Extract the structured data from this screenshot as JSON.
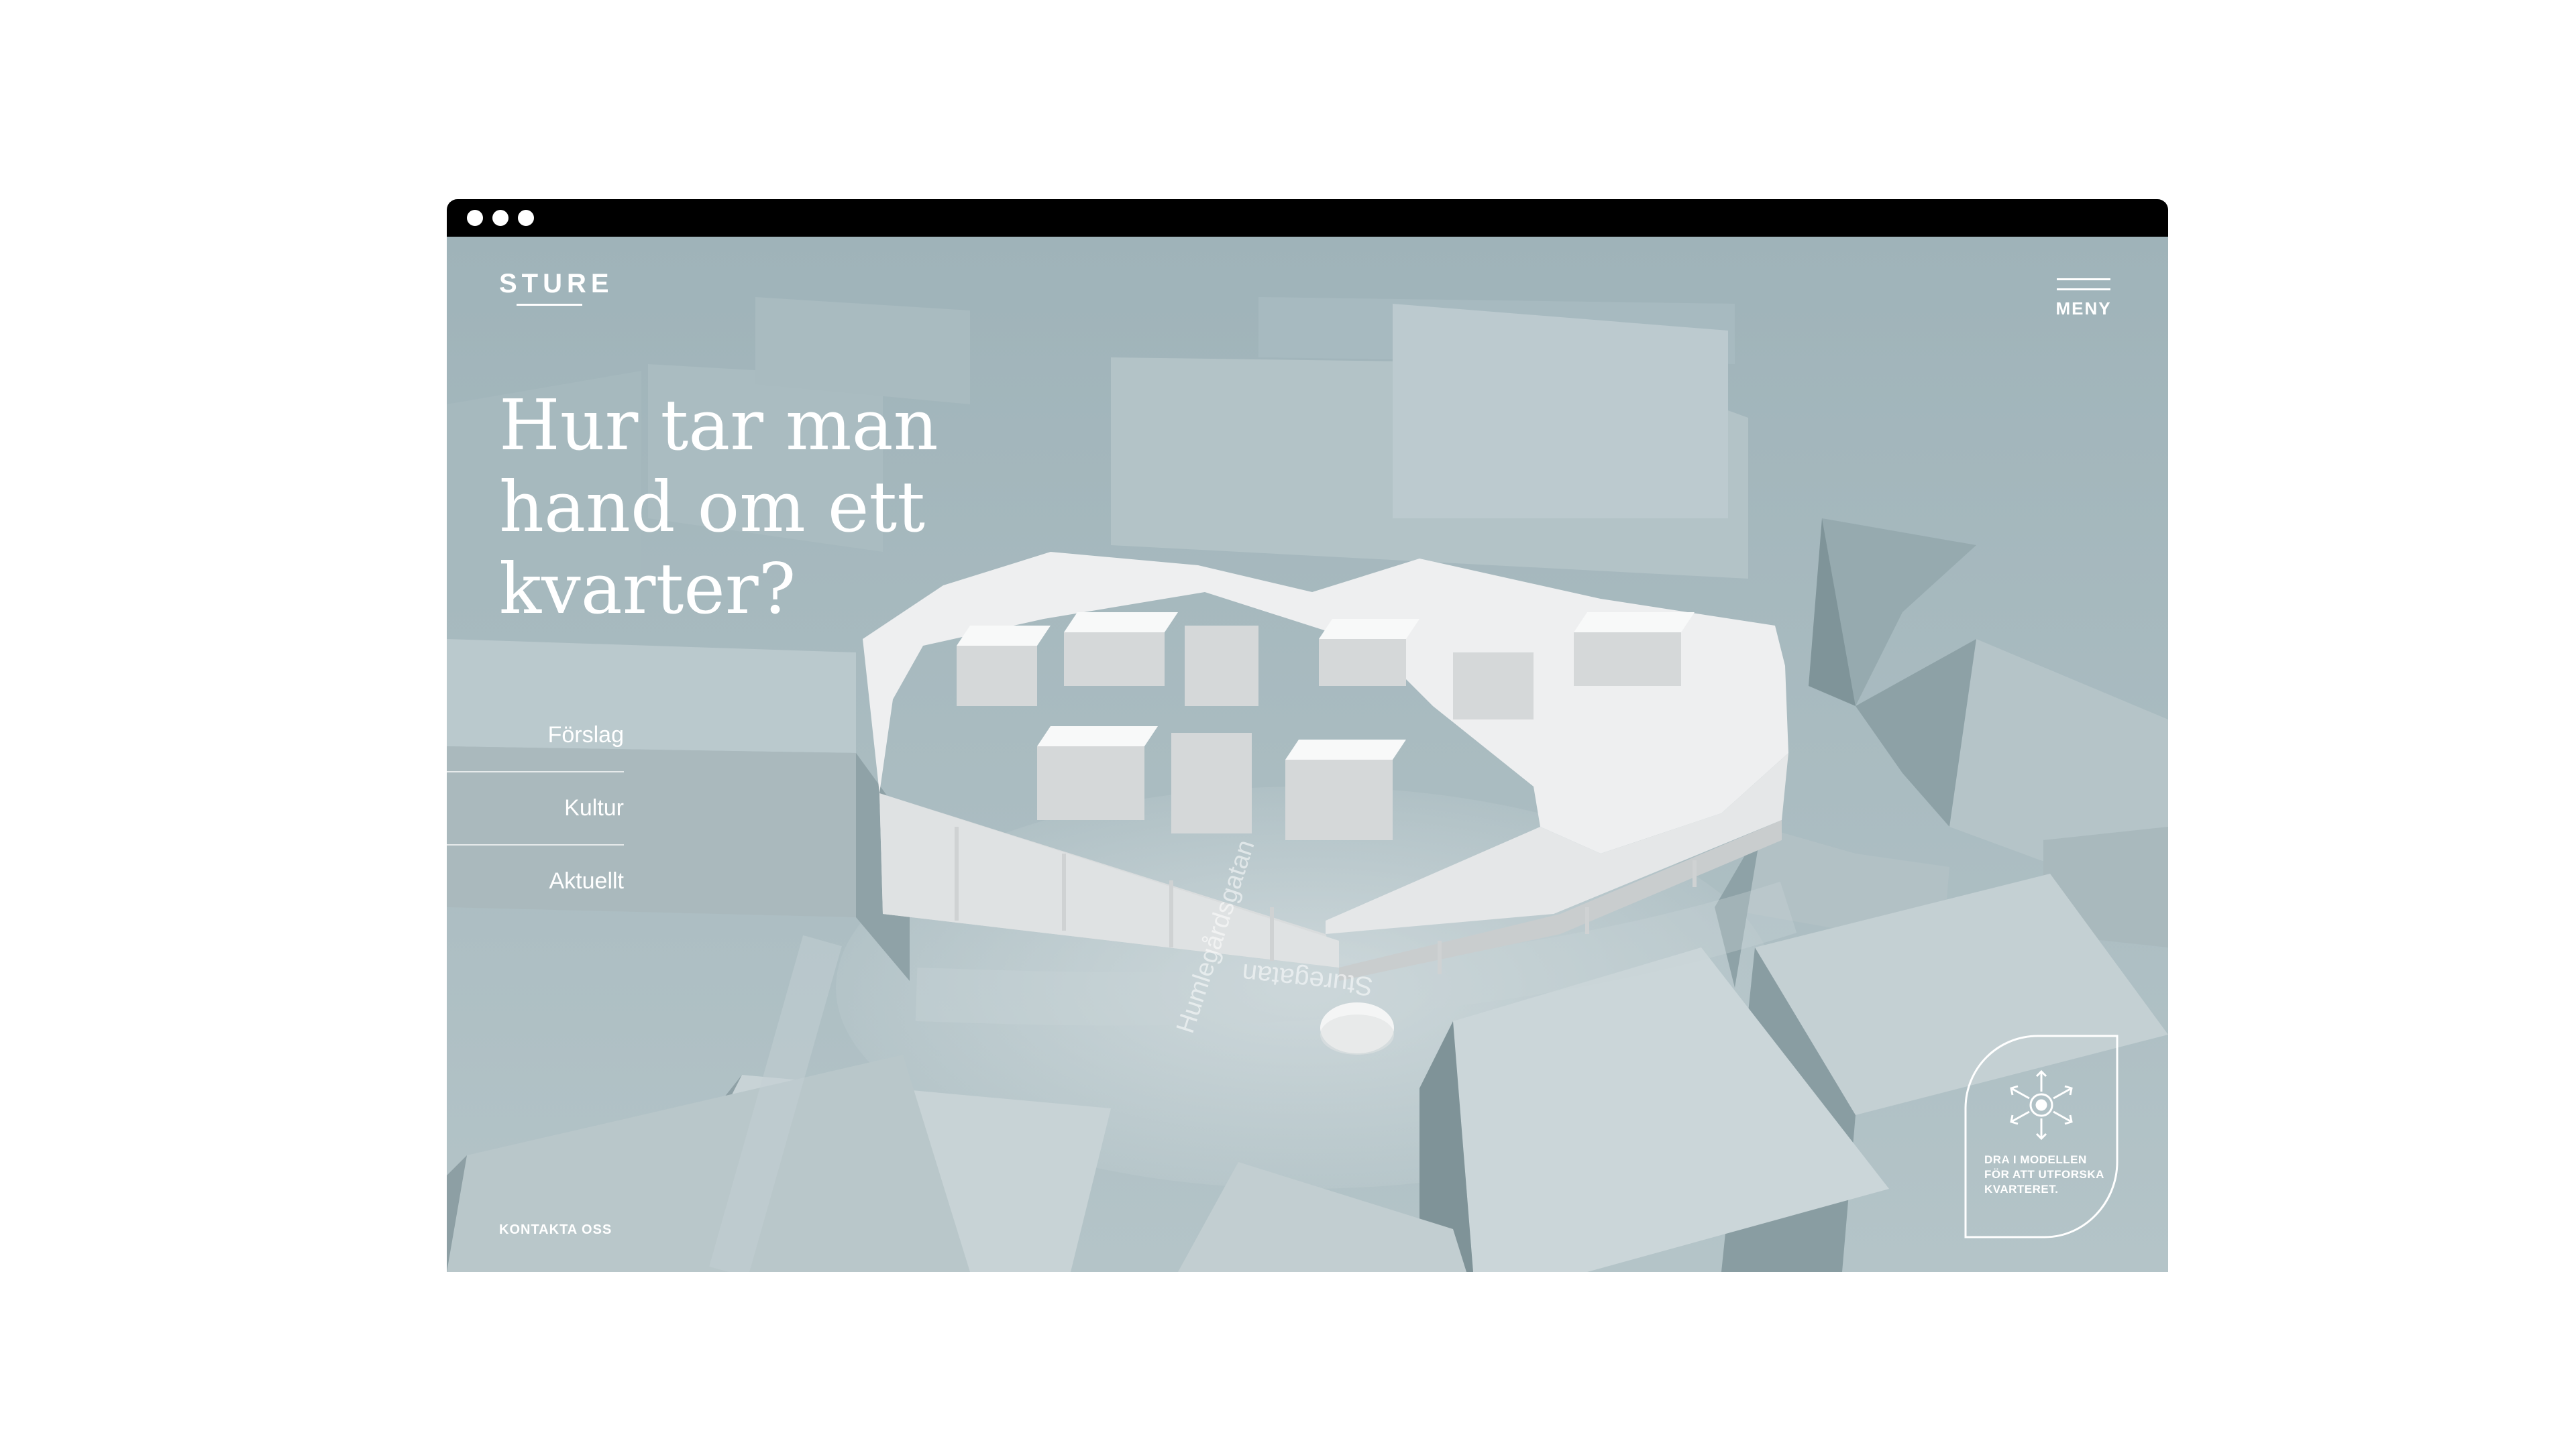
{
  "site": {
    "logo": "STURE",
    "menu_label": "MENY",
    "headline": "Hur tar man hand om ett kvarter?",
    "nav": [
      {
        "label": "Förslag"
      },
      {
        "label": "Kultur"
      },
      {
        "label": "Aktuellt"
      }
    ],
    "contact_label": "KONTAKTA OSS",
    "drag_hint": "DRA I MODELLEN FÖR ATT UTFORSKA KVARTERET.",
    "streets": {
      "humlegardsgatan": "Humlegårdsgatan",
      "sturegatan": "Sturegatan"
    }
  },
  "colors": {
    "scene_background": "#a3b6bb",
    "model_white": "#f2f3f3",
    "text": "#ffffff",
    "browser_bar": "#000000"
  },
  "icons": {
    "menu": "hamburger-menu-icon",
    "drag": "drag-arrows-icon"
  }
}
